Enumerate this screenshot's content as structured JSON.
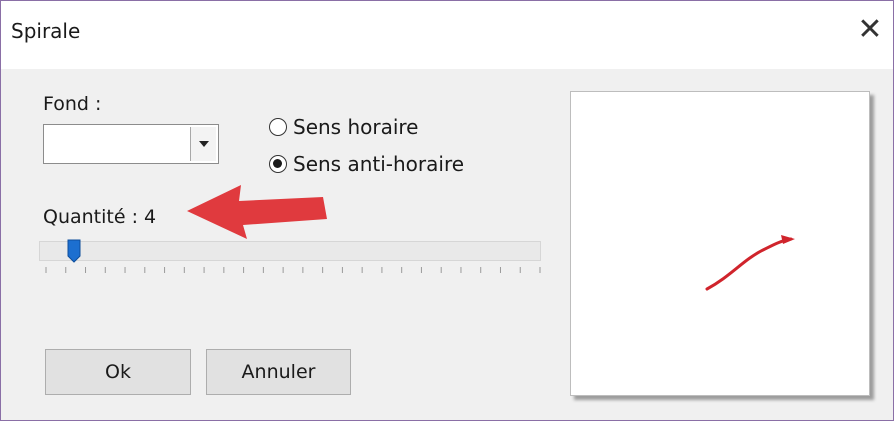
{
  "window": {
    "title": "Spirale",
    "close_glyph": "✕"
  },
  "fond": {
    "label": "Fond :",
    "value": ""
  },
  "direction": {
    "options": [
      {
        "label": "Sens horaire",
        "checked": false
      },
      {
        "label": "Sens anti-horaire",
        "checked": true
      }
    ]
  },
  "quantity": {
    "label": "Quantité : 4",
    "value": 4,
    "min": 0,
    "max": 50,
    "tick_count": 25
  },
  "buttons": {
    "ok": "Ok",
    "cancel": "Annuler"
  },
  "preview": {
    "stroke_color": "#d0242c"
  },
  "annotation": {
    "arrow_color": "#e03a3e"
  }
}
